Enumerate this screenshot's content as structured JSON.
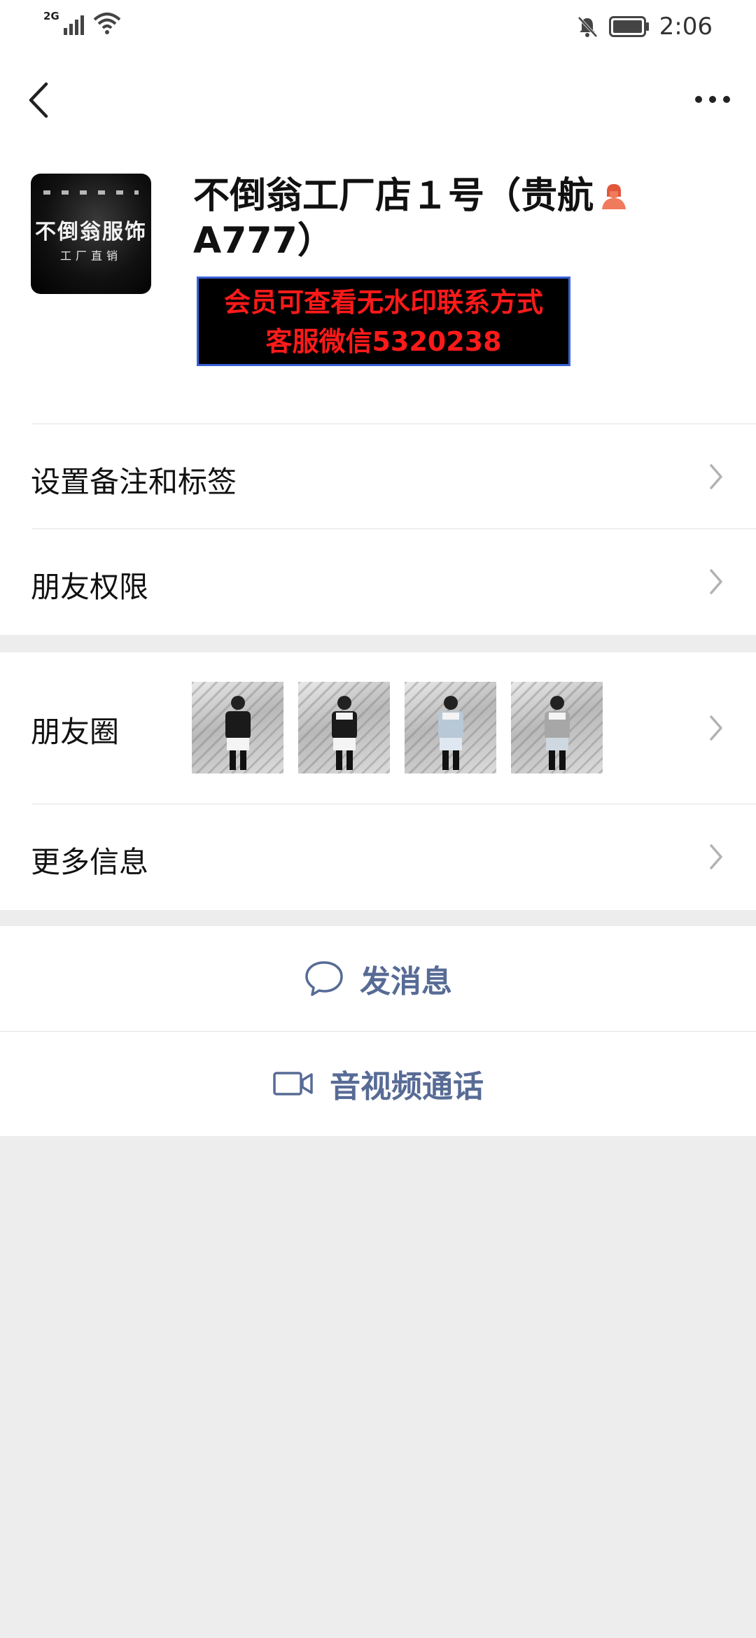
{
  "status_bar": {
    "network": "2G",
    "time": "2:06"
  },
  "nav": {
    "back_icon": "chevron-left-icon",
    "more_icon": "more-dots-icon"
  },
  "profile": {
    "avatar_text": "不倒翁服饰",
    "avatar_subtext": "工厂直销",
    "name": "不倒翁工厂店１号（贵航",
    "name_line2": "A777）",
    "gender_icon": "female-icon",
    "watermark_line1": "会员可查看无水印联系方式",
    "watermark_line2": "客服微信5320238"
  },
  "rows": {
    "remarks": "设置备注和标签",
    "permissions": "朋友权限",
    "moments": "朋友圈",
    "more_info": "更多信息"
  },
  "actions": {
    "message": "发消息",
    "call": "音视频通话"
  },
  "colors": {
    "link": "#576b95",
    "background": "#ededed",
    "watermark_text": "#ff1a1a"
  }
}
